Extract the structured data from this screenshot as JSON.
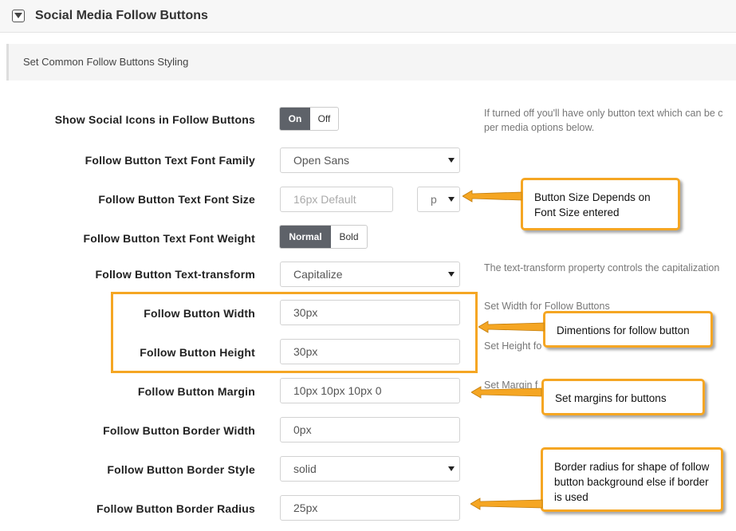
{
  "header": {
    "title": "Social Media Follow Buttons",
    "toggle_icon": "chevron-down-icon"
  },
  "section": {
    "label": "Set Common Follow Buttons Styling"
  },
  "rows": {
    "show_icons": {
      "label": "Show Social Icons in Follow Buttons",
      "on": "On",
      "off": "Off",
      "selected": "On",
      "help": [
        "If turned off you'll have only button text which can be c",
        "per media options below."
      ]
    },
    "font_family": {
      "label": "Follow Button Text Font Family",
      "value": "Open Sans"
    },
    "font_size": {
      "label": "Follow Button Text Font Size",
      "placeholder": "16px Default",
      "unit": "p"
    },
    "font_weight": {
      "label": "Follow Button Text Font Weight",
      "normal": "Normal",
      "bold": "Bold",
      "selected": "Normal"
    },
    "text_transform": {
      "label": "Follow Button Text-transform",
      "value": "Capitalize",
      "help": "The text-transform property controls the capitalization"
    },
    "width": {
      "label": "Follow Button Width",
      "value": "30px",
      "help": "Set Width for Follow Buttons"
    },
    "height": {
      "label": "Follow Button Height",
      "value": "30px",
      "help": "Set Height fo"
    },
    "margin": {
      "label": "Follow Button Margin",
      "value": "10px 10px 10px 0",
      "help": "Set Margin f"
    },
    "border_width": {
      "label": "Follow Button Border Width",
      "value": "0px"
    },
    "border_style": {
      "label": "Follow Button Border Style",
      "value": "solid"
    },
    "border_radius": {
      "label": "Follow Button Border Radius",
      "value": "25px"
    }
  },
  "callouts": {
    "font_size": "Button Size Depends on Font Size entered",
    "dimensions": "Dimentions for follow button",
    "margins": "Set margins for buttons",
    "radius": "Border radius for shape of follow button background else if border is used"
  },
  "colors": {
    "accent": "#f5a623",
    "toggle_active": "#5e6269"
  }
}
